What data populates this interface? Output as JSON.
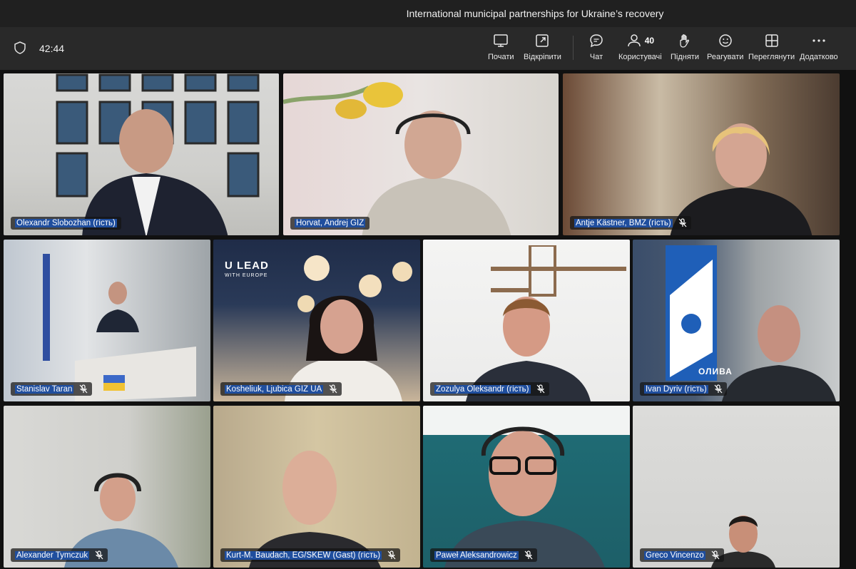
{
  "meeting": {
    "title": "International municipal partnerships for Ukraine’s recovery",
    "timer": "42:44"
  },
  "toolbar": {
    "start_label": "Почати",
    "unpin_label": "Відкріпити",
    "chat_label": "Чат",
    "users_label": "Користувачі",
    "users_count": "40",
    "raise_label": "Підняти",
    "react_label": "Реагувати",
    "view_label": "Переглянути",
    "more_label": "Додатково"
  },
  "participants": [
    {
      "name": "Olexandr Slobozhan (гість)",
      "muted": false,
      "active": true
    },
    {
      "name": "Horvat, Andrej GIZ",
      "muted": false
    },
    {
      "name": "Antje Kästner, BMZ (гість)",
      "muted": true
    },
    {
      "name": "Stanislav Taran",
      "muted": true
    },
    {
      "name": "Kosheliuk, Ljubica GIZ UA",
      "muted": true
    },
    {
      "name": "Zozulya Oleksandr (гість)",
      "muted": true
    },
    {
      "name": "Ivan Dyriv (гість)",
      "muted": true
    },
    {
      "name": "Alexander Tymczuk",
      "muted": true
    },
    {
      "name": "Kurt-M. Baudach, EG/SKEW (Gast) (гість)",
      "muted": true
    },
    {
      "name": "Paweł Aleksandrowicz",
      "muted": true
    },
    {
      "name": "Greco Vincenzo",
      "muted": true
    }
  ],
  "backgrounds": {
    "ulead_logo": "U LEAD",
    "ulead_sub": "WITH EUROPE",
    "banner_text": "ОЛИВА"
  },
  "colors": {
    "accent": "#8b8cf4",
    "name_highlight": "#1f4e9e"
  }
}
